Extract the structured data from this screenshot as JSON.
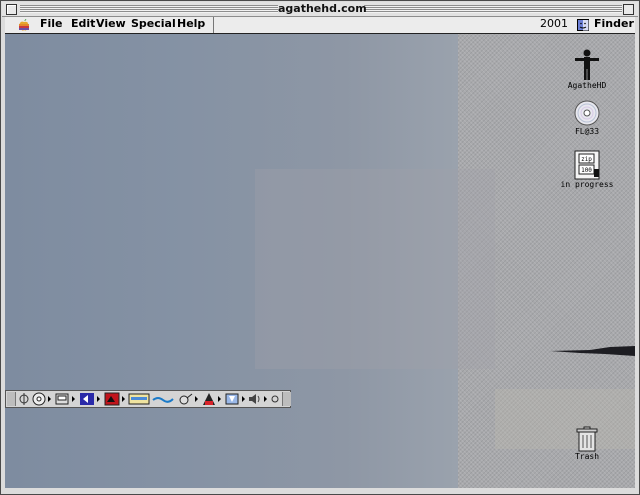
{
  "window": {
    "title": "agathehd.com"
  },
  "menubar": {
    "items": [
      "File",
      "Edit",
      "View",
      "Special",
      "Help"
    ],
    "clock": "2001",
    "app_name": "Finder"
  },
  "desktop_icons": [
    {
      "label": "AgatheHD",
      "icon": "hard-disk-figure-icon"
    },
    {
      "label": "FL@33",
      "icon": "cd-disc-icon"
    },
    {
      "label": "in progress",
      "icon": "zip-disk-icon"
    },
    {
      "label": "Trash",
      "icon": "trash-can-icon"
    }
  ],
  "control_strip": {
    "modules": [
      "appletalk-icon",
      "cd-strip-icon",
      "file-sharing-icon",
      "keychain-icon",
      "monitor-depth-icon",
      "monitor-resolution-icon",
      "remote-access-icon",
      "location-icon",
      "printer-icon",
      "energy-icon",
      "sound-icon"
    ]
  }
}
